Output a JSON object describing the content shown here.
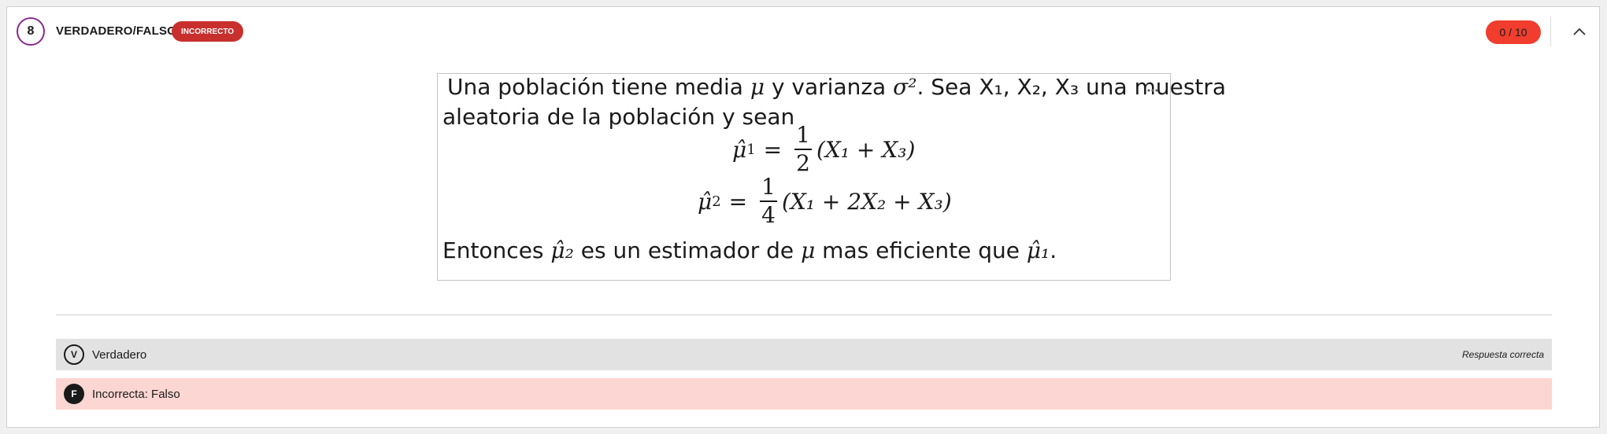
{
  "question": {
    "number": "8",
    "type": "VERDADERO/FALSO",
    "status": "INCORRECTO",
    "score": "0 / 10",
    "collapse_icon": "chevron-up-icon"
  },
  "statement": {
    "line1_prefix": " Una población tiene media ",
    "mu": "μ",
    "line1_mid": " y varianza ",
    "sigma2": "σ²",
    "line1_suffix": ". Sea X₁, X₂, X₃ una muestra",
    "line2": "aleatoria de la población y sean",
    "eq1": {
      "lhs": "μ̂",
      "lhs_sub": "1",
      "frac_num": "1",
      "frac_den": "2",
      "rhs": "(X₁ + X₃)"
    },
    "eq2": {
      "lhs": "μ̂",
      "lhs_sub": "2",
      "frac_num": "1",
      "frac_den": "4",
      "rhs": "(X₁ + 2X₂ + X₃)"
    },
    "line5_prefix": "Entonces ",
    "line5_est2": "μ̂₂",
    "line5_mid": " es un estimador de ",
    "line5_mu": "μ",
    "line5_mid2": " mas eficiente que ",
    "line5_est1": "μ̂₁",
    "line5_suffix": "."
  },
  "answers": [
    {
      "letter": "V",
      "label": "Verdadero",
      "note": "Respuesta correcta"
    },
    {
      "letter": "F",
      "label": "Incorrecta: Falso",
      "note": ""
    }
  ],
  "colors": {
    "status_badge": "#c8302d",
    "score_badge": "#f03d2e",
    "number_ring": "#8a2a8e",
    "incorrect_row": "#fcd6d2",
    "correct_row": "#e2e2e2"
  }
}
